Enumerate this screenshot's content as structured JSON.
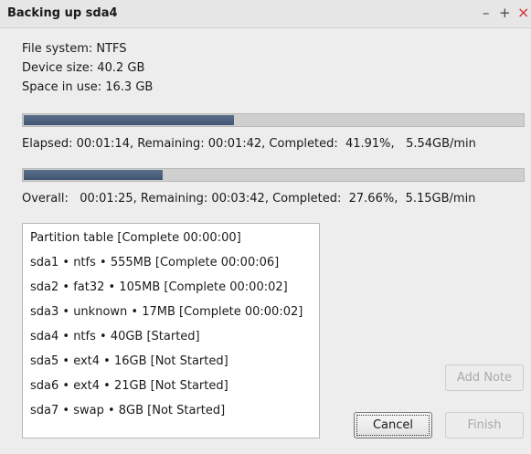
{
  "window": {
    "title": "Backing up sda4",
    "controls": {
      "minimize": "–",
      "maximize": "+",
      "close": "×"
    }
  },
  "info": {
    "file_system": "File system:  NTFS",
    "device_size": "Device size:  40.2 GB",
    "space_in_use": "Space in use:  16.3 GB"
  },
  "partition_progress": {
    "fraction": 0.4191,
    "status": "Elapsed: 00:01:14, Remaining: 00:01:42, Completed:  41.91%,   5.54GB/min"
  },
  "overall_progress": {
    "fraction": 0.2766,
    "status": "Overall:   00:01:25, Remaining: 00:03:42, Completed:  27.66%,  5.15GB/min"
  },
  "partitions": [
    "Partition table [Complete 00:00:00]",
    "sda1 • ntfs • 555MB [Complete 00:00:06]",
    "sda2 • fat32 • 105MB [Complete 00:00:02]",
    "sda3 • unknown • 17MB [Complete 00:00:02]",
    "sda4 • ntfs • 40GB [Started]",
    "sda5 • ext4 • 16GB [Not Started]",
    "sda6 • ext4 • 21GB [Not Started]",
    "sda7 • swap • 8GB [Not Started]"
  ],
  "buttons": {
    "add_note": "Add Note",
    "cancel": "Cancel",
    "finish": "Finish"
  },
  "colors": {
    "progress_fill": "#4a5f7c",
    "progress_track": "#cfcfcf",
    "close_button": "#d03030"
  }
}
